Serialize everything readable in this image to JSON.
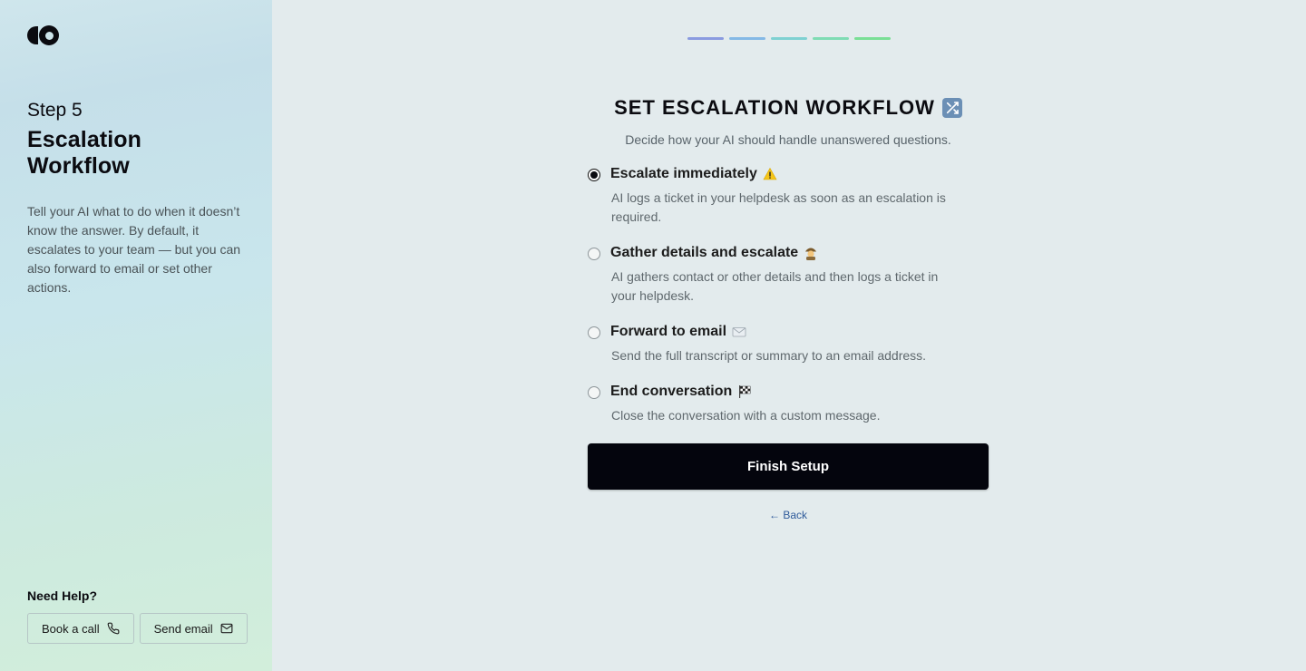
{
  "sidebar": {
    "logo_icon": "brand-logo",
    "step_label": "Step 5",
    "step_title": "Escalation Workflow",
    "description": "Tell your AI what to do when it doesn’t know the answer. By default, it escalates to your team — but you can also forward to email or set other actions.",
    "help": {
      "title": "Need Help?",
      "book_call_label": "Book a call",
      "book_call_icon": "phone-icon",
      "send_email_label": "Send email",
      "send_email_icon": "mail-icon"
    }
  },
  "progress": {
    "total_steps": 5,
    "completed_steps": 5,
    "colors": [
      "#8a9be0",
      "#84b9e6",
      "#7fd1d2",
      "#7fdcb4",
      "#7adf96"
    ]
  },
  "main": {
    "title": "SET ESCALATION WORKFLOW",
    "title_icon": "shuffle-icon",
    "subtitle": "Decide how your AI should handle unanswered questions.",
    "options": [
      {
        "label": "Escalate immediately",
        "icon": "warning-icon",
        "description": "AI logs a ticket in your helpdesk as soon as an escalation is required.",
        "selected": true
      },
      {
        "label": "Gather details and escalate",
        "icon": "detective-icon",
        "description": "AI gathers contact or other details and then logs a ticket in your helpdesk.",
        "selected": false
      },
      {
        "label": "Forward to email",
        "icon": "envelope-icon",
        "description": "Send the full transcript or summary to an email address.",
        "selected": false
      },
      {
        "label": "End conversation",
        "icon": "checkered-flag-icon",
        "description": "Close the conversation with a custom message.",
        "selected": false
      }
    ],
    "finish_label": "Finish Setup",
    "back_label": "← Back"
  }
}
